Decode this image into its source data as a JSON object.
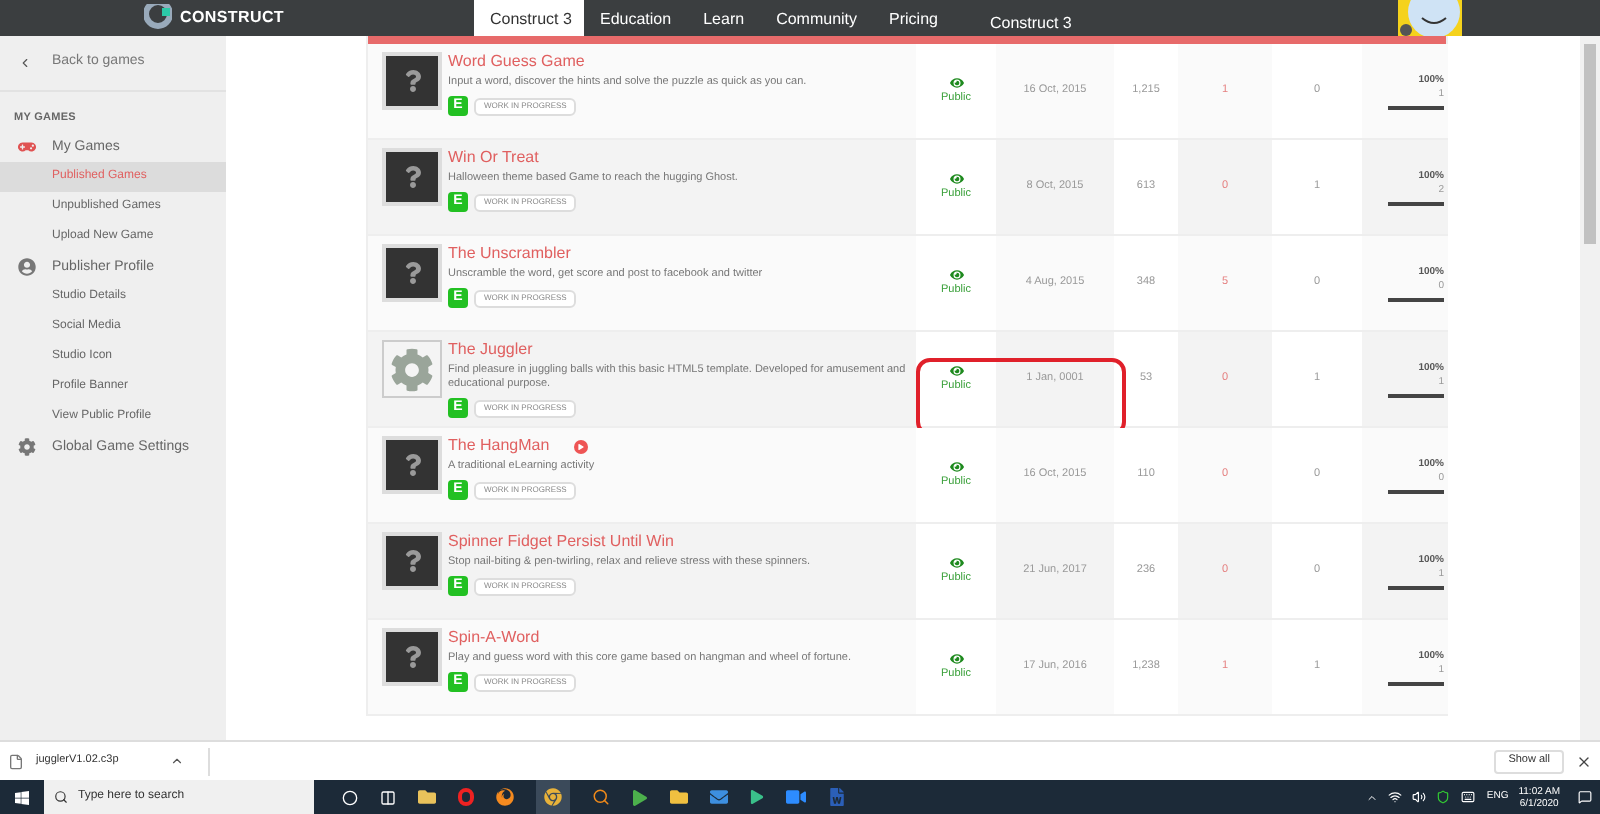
{
  "header": {
    "logo": "CONSTRUCT",
    "tabs": [
      {
        "label": "Construct 3",
        "selected": true
      },
      {
        "label": "Education",
        "selected": false
      },
      {
        "label": "Learn",
        "selected": false
      },
      {
        "label": "Community",
        "selected": false
      },
      {
        "label": "Pricing",
        "selected": false
      }
    ],
    "launch_button": "Construct 3"
  },
  "sidebar": {
    "back": "Back to games",
    "heading": "MY GAMES",
    "items": [
      {
        "label": "My Games",
        "selected": false,
        "children": [
          {
            "label": "Published Games",
            "selected": true
          },
          {
            "label": "Unpublished Games",
            "selected": false
          },
          {
            "label": "Upload New Game",
            "selected": false
          }
        ]
      },
      {
        "label": "Publisher Profile",
        "selected": false,
        "children": [
          {
            "label": "Studio Details",
            "selected": false
          },
          {
            "label": "Social Media",
            "selected": false
          },
          {
            "label": "Studio Icon",
            "selected": false
          },
          {
            "label": "Profile Banner",
            "selected": false
          },
          {
            "label": "View Public Profile",
            "selected": false
          }
        ]
      },
      {
        "label": "Global Game Settings",
        "selected": false
      }
    ]
  },
  "games": [
    {
      "kind": "unknown",
      "title": "Word Guess Game",
      "description": "Input a word, discover the hints and solve the puzzle as quick as you can.",
      "badge": "E",
      "status": "WORK IN PROGRESS",
      "marker": false,
      "visibility": "Public",
      "date": "16 Oct, 2015",
      "column_4": "1,215",
      "column_5": "1",
      "column_6": "0",
      "rating": "100%",
      "rating_count": "1",
      "level": 1,
      "circled": false
    },
    {
      "kind": "unknown",
      "title": "Win Or Treat",
      "description": "Halloween theme based Game to reach the hugging Ghost.",
      "badge": "E",
      "status": "WORK IN PROGRESS",
      "marker": false,
      "visibility": "Public",
      "date": "8 Oct, 2015",
      "column_4": "613",
      "column_5": "0",
      "column_6": "1",
      "rating": "100%",
      "rating_count": "2",
      "level": 1,
      "circled": false
    },
    {
      "kind": "unknown",
      "title": "The Unscrambler",
      "description": "Unscramble the word, get score and post to facebook and twitter",
      "badge": "E",
      "status": "WORK IN PROGRESS",
      "marker": false,
      "visibility": "Public",
      "date": "4 Aug, 2015",
      "column_4": "348",
      "column_5": "5",
      "column_6": "0",
      "rating": "100%",
      "rating_count": "0",
      "level": 1,
      "circled": false
    },
    {
      "kind": "gear",
      "title": "The Juggler",
      "description": "Find pleasure in juggling balls with this basic HTML5 template. Developed for amusement and educational purpose.",
      "badge": "E",
      "status": "WORK IN PROGRESS",
      "marker": false,
      "visibility": "Public",
      "date": "1 Jan, 0001",
      "column_4": "53",
      "column_5": "0",
      "column_6": "1",
      "rating": "100%",
      "rating_count": "1",
      "level": 1,
      "circled": true
    },
    {
      "kind": "unknown",
      "title": "The HangMan",
      "description": "A traditional eLearning activity",
      "badge": "E",
      "status": "WORK IN PROGRESS",
      "marker": true,
      "visibility": "Public",
      "date": "16 Oct, 2015",
      "column_4": "110",
      "column_5": "0",
      "column_6": "0",
      "rating": "100%",
      "rating_count": "0",
      "level": 1,
      "circled": false
    },
    {
      "kind": "unknown",
      "title": "Spinner Fidget Persist Until Win",
      "description": "Stop nail-biting & pen-twirling, relax and relieve stress with these spinners.",
      "badge": "E",
      "status": "WORK IN PROGRESS",
      "marker": false,
      "visibility": "Public",
      "date": "21 Jun, 2017",
      "column_4": "236",
      "column_5": "0",
      "column_6": "0",
      "rating": "100%",
      "rating_count": "1",
      "level": 1,
      "circled": false
    },
    {
      "kind": "unknown",
      "title": "Spin-A-Word",
      "description": "Play and guess word with this core game based on hangman and wheel of fortune.",
      "badge": "E",
      "status": "WORK IN PROGRESS",
      "marker": false,
      "visibility": "Public",
      "date": "17 Jun, 2016",
      "column_4": "1,238",
      "column_5": "1",
      "column_6": "1",
      "rating": "100%",
      "rating_count": "1",
      "level": 1,
      "circled": false
    }
  ],
  "download_bar": {
    "file": "jugglerV1.02.c3p",
    "show_all": "Show all"
  },
  "taskbar": {
    "search_placeholder": "Type here to search",
    "language": "ENG",
    "time": "11:02 AM",
    "date": "6/1/2020"
  }
}
